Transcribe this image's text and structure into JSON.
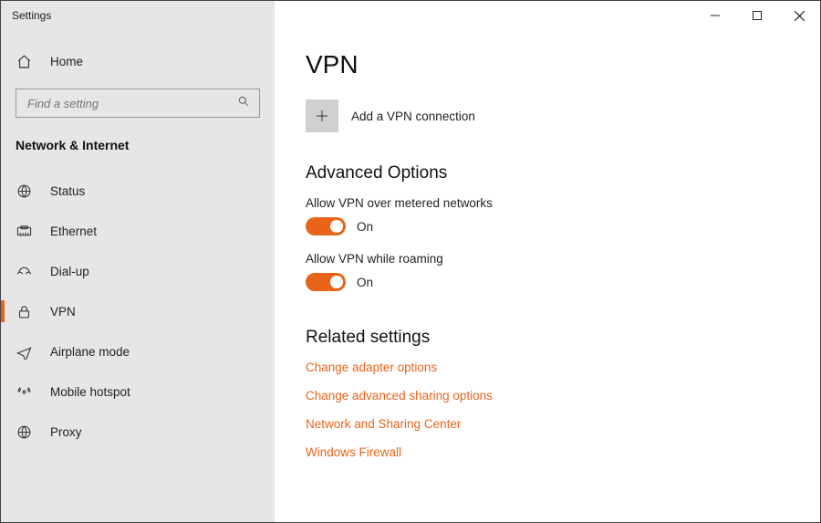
{
  "window": {
    "title": "Settings"
  },
  "sidebar": {
    "home_label": "Home",
    "search_placeholder": "Find a setting",
    "category_title": "Network & Internet",
    "items": [
      {
        "label": "Status"
      },
      {
        "label": "Ethernet"
      },
      {
        "label": "Dial-up"
      },
      {
        "label": "VPN"
      },
      {
        "label": "Airplane mode"
      },
      {
        "label": "Mobile hotspot"
      },
      {
        "label": "Proxy"
      }
    ]
  },
  "main": {
    "page_title": "VPN",
    "add_label": "Add a VPN connection",
    "advanced_heading": "Advanced Options",
    "opt1_label": "Allow VPN over metered networks",
    "opt1_state": "On",
    "opt2_label": "Allow VPN while roaming",
    "opt2_state": "On",
    "related_heading": "Related settings",
    "links": [
      "Change adapter options",
      "Change advanced sharing options",
      "Network and Sharing Center",
      "Windows Firewall"
    ]
  },
  "colors": {
    "accent": "#e8641b",
    "sidebar_bg": "#e6e6e6"
  }
}
